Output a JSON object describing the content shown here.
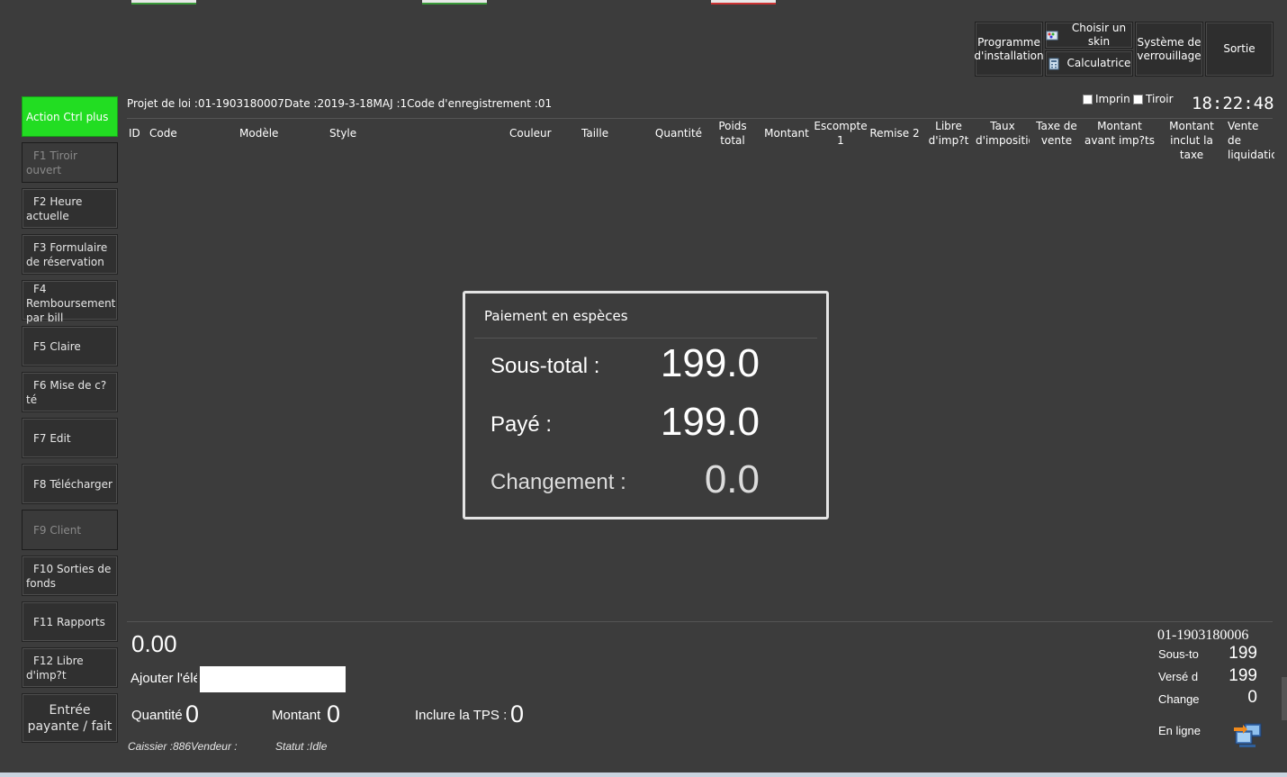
{
  "toolbar": {
    "install_label": "Programme d'installation",
    "skin_label": "Choisir un skin",
    "calc_label": "Calculatrice",
    "lock_label": "Système de verrouillage",
    "exit_label": "Sortie"
  },
  "sidebar": {
    "items": [
      {
        "label": "Action Ctrl plus"
      },
      {
        "label": "F1 Tiroir ouvert"
      },
      {
        "label": "F2 Heure actuelle"
      },
      {
        "label": "F3 Formulaire de réservation"
      },
      {
        "label": "F4 Remboursement par bill"
      },
      {
        "label": "F5 Claire"
      },
      {
        "label": "F6 Mise de c?té"
      },
      {
        "label": "F7 Edit"
      },
      {
        "label": "F8 Télécharger"
      },
      {
        "label": "F9 Client"
      },
      {
        "label": "F10 Sorties de fonds"
      },
      {
        "label": "F11 Rapports"
      },
      {
        "label": "F12 Libre d'imp?t"
      },
      {
        "label": "Entrée payante / fait"
      }
    ]
  },
  "info": {
    "line": "Projet de loi :01-1903180007Date :2019-3-18MAJ :1Code d'enregistrement :01",
    "print_label": "Imprin",
    "drawer_label": "Tiroir",
    "clock": "18:22:48"
  },
  "table": {
    "columns": [
      "ID",
      "Code",
      "Modèle",
      "Style",
      "Couleur",
      "Taille",
      "Quantité",
      "Poids total",
      "Montant",
      "Escompte 1",
      "Remise 2",
      "Libre d'imp?t",
      "Taux d'impositio",
      "Taxe de vente",
      "Montant avant imp?ts",
      "Montant inclut la taxe",
      "Vente de liquidatic"
    ]
  },
  "dialog": {
    "title": "Paiement en espèces",
    "subtotal_label": "Sous-total :",
    "subtotal_value": "199.0",
    "paid_label": "Payé :",
    "paid_value": "199.0",
    "change_label": "Changement :",
    "change_value": "0.0"
  },
  "bottom": {
    "total": "0.00",
    "add_label": "Ajouter l'élé",
    "qty_label": "Quantité",
    "qty_value": "0",
    "amount_label": "Montant",
    "amount_value": "0",
    "tps_label": "Inclure la TPS :",
    "tps_value": "0",
    "cashier": "Caissier :886Vendeur :",
    "status": "Statut :Idle"
  },
  "right_panel": {
    "bill_id": "01-1903180006",
    "subtotal_label": "Sous-to",
    "subtotal_value": "199",
    "paid_label": "Versé d",
    "paid_value": "199",
    "change_label": "Change",
    "change_value": "0",
    "online_label": "En ligne"
  }
}
